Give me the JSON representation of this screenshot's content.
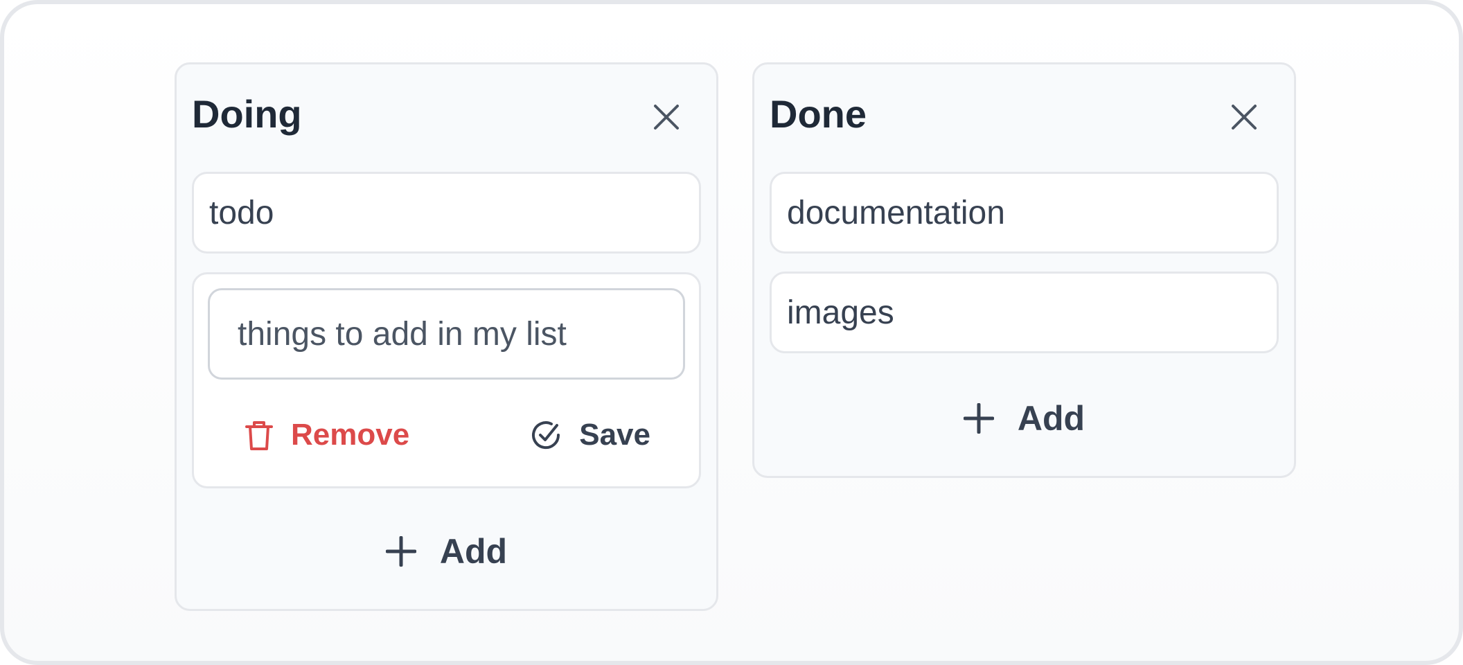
{
  "lists": [
    {
      "title": "Doing",
      "close_icon": "close-icon",
      "items": [
        {
          "text": "todo"
        }
      ],
      "editor": {
        "value": "",
        "placeholder": "things to add in my list",
        "remove_label": "Remove",
        "save_label": "Save"
      },
      "add_label": "Add"
    },
    {
      "title": "Done",
      "close_icon": "close-icon",
      "items": [
        {
          "text": "documentation"
        },
        {
          "text": "images"
        }
      ],
      "add_label": "Add"
    }
  ],
  "colors": {
    "text": "#1f2937",
    "danger": "#dc4a4a",
    "border": "#e5e7eb",
    "panel": "#f8fafc"
  }
}
